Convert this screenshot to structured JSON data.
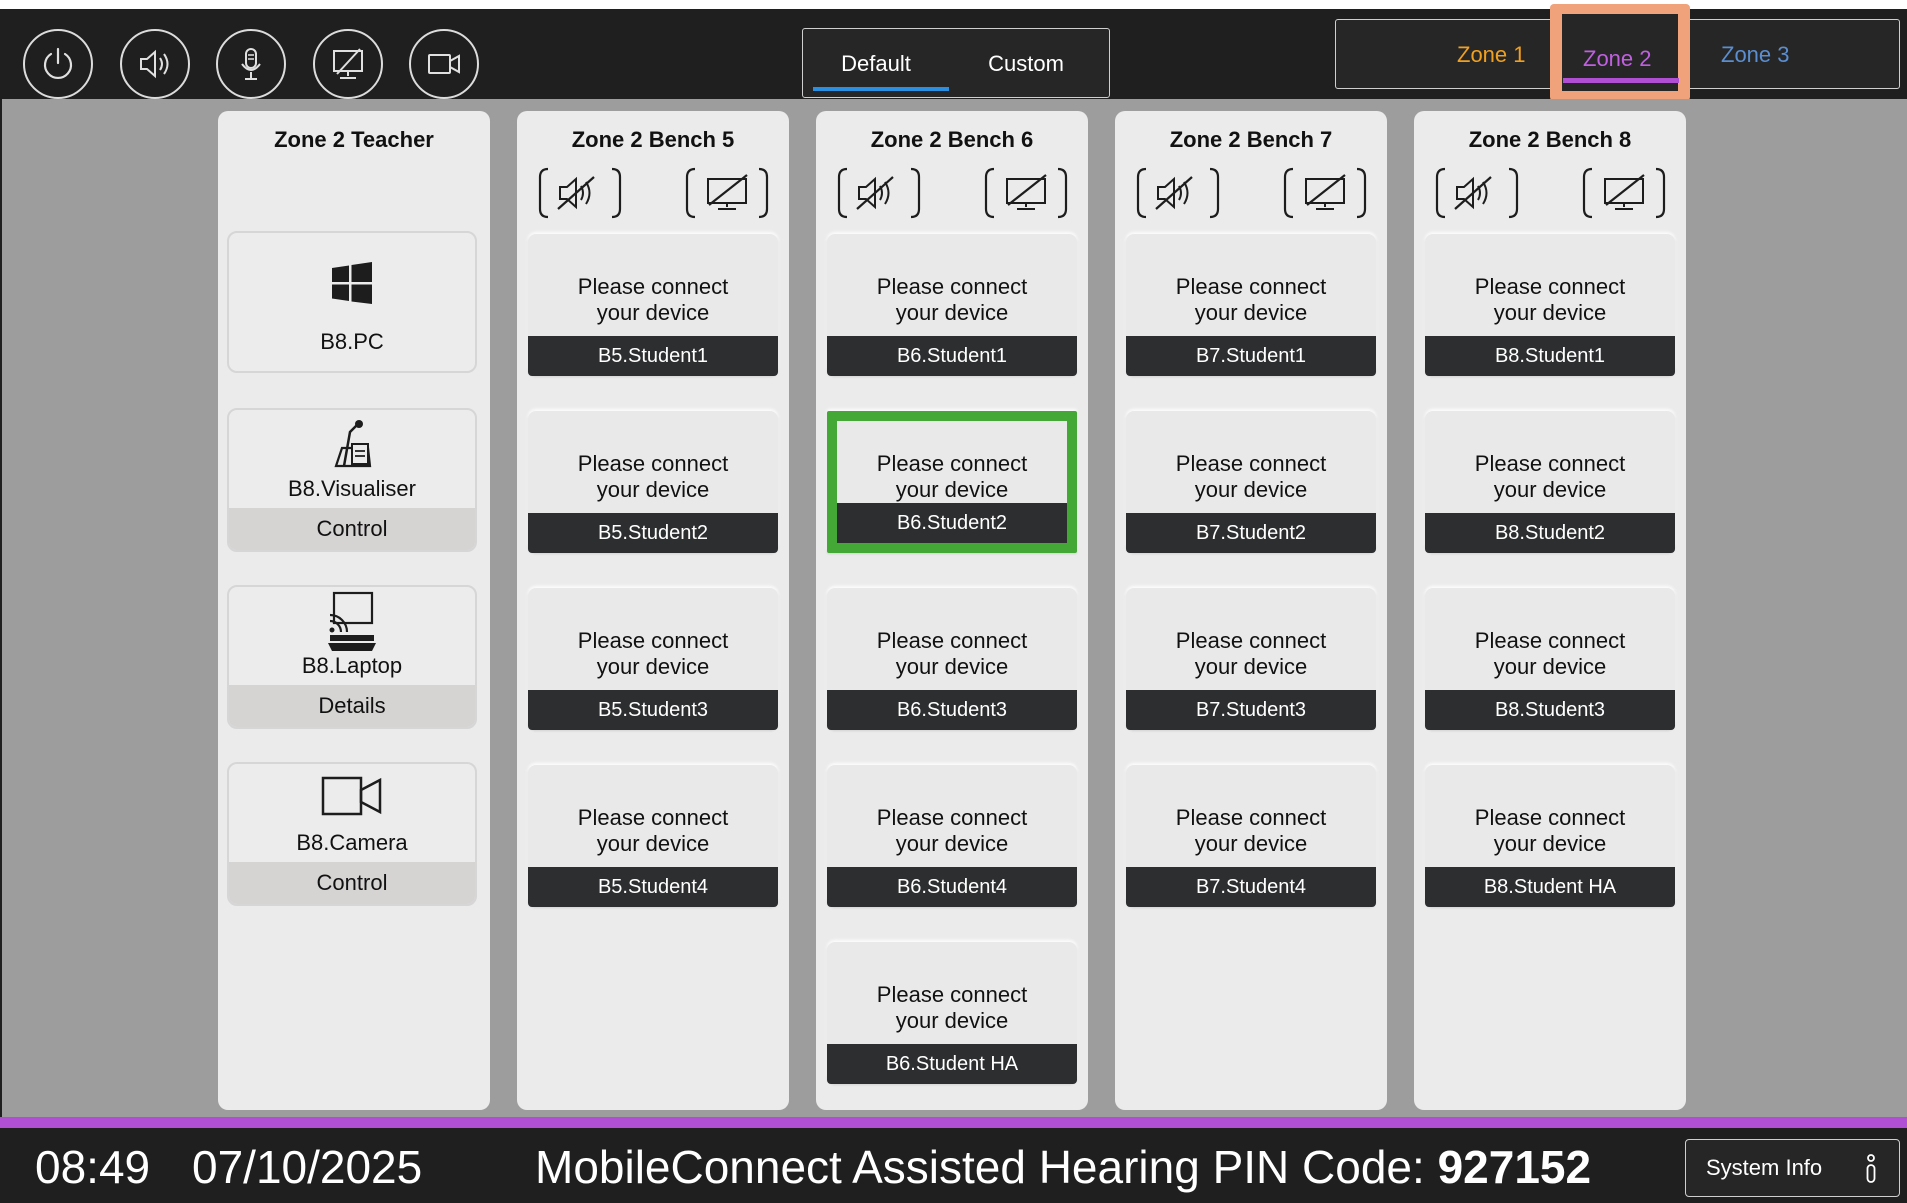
{
  "topbar": {
    "buttons": [
      "power-icon",
      "speaker-icon",
      "microphone-icon",
      "display-off-icon",
      "camera-icon"
    ],
    "mode_tabs": [
      {
        "label": "Default",
        "active": true
      },
      {
        "label": "Custom",
        "active": false
      }
    ],
    "zones": [
      {
        "label": "Zone 1",
        "color": "#f0a020"
      },
      {
        "label": "Zone 2",
        "color": "#c060e0",
        "active": true
      },
      {
        "label": "Zone 3",
        "color": "#5b8ed0"
      }
    ]
  },
  "teacher": {
    "title": "Zone 2 Teacher",
    "devices": [
      {
        "name": "B8.PC",
        "icon": "windows-icon",
        "action": ""
      },
      {
        "name": "B8.Visualiser",
        "icon": "visualiser-icon",
        "action": "Control"
      },
      {
        "name": "B8.Laptop",
        "icon": "laptop-cast-icon",
        "action": "Details"
      },
      {
        "name": "B8.Camera",
        "icon": "camera-icon",
        "action": "Control"
      }
    ]
  },
  "benches": [
    {
      "title": "Zone 2 Bench 5",
      "cards": [
        {
          "message": [
            "Please connect",
            "your device"
          ],
          "label": "B5.Student1"
        },
        {
          "message": [
            "Please connect",
            "your device"
          ],
          "label": "B5.Student2"
        },
        {
          "message": [
            "Please connect",
            "your device"
          ],
          "label": "B5.Student3"
        },
        {
          "message": [
            "Please connect",
            "your device"
          ],
          "label": "B5.Student4"
        }
      ]
    },
    {
      "title": "Zone 2 Bench 6",
      "cards": [
        {
          "message": [
            "Please connect",
            "your device"
          ],
          "label": "B6.Student1"
        },
        {
          "message": [
            "Please connect",
            "your device"
          ],
          "label": "B6.Student2",
          "selected": true
        },
        {
          "message": [
            "Please connect",
            "your device"
          ],
          "label": "B6.Student3"
        },
        {
          "message": [
            "Please connect",
            "your device"
          ],
          "label": "B6.Student4"
        },
        {
          "message": [
            "Please connect",
            "your device"
          ],
          "label": "B6.Student HA"
        }
      ]
    },
    {
      "title": "Zone 2 Bench 7",
      "cards": [
        {
          "message": [
            "Please connect",
            "your device"
          ],
          "label": "B7.Student1"
        },
        {
          "message": [
            "Please connect",
            "your device"
          ],
          "label": "B7.Student2"
        },
        {
          "message": [
            "Please connect",
            "your device"
          ],
          "label": "B7.Student3"
        },
        {
          "message": [
            "Please connect",
            "your device"
          ],
          "label": "B7.Student4"
        }
      ]
    },
    {
      "title": "Zone 2 Bench 8",
      "cards": [
        {
          "message": [
            "Please connect",
            "your device"
          ],
          "label": "B8.Student1"
        },
        {
          "message": [
            "Please connect",
            "your device"
          ],
          "label": "B8.Student2"
        },
        {
          "message": [
            "Please connect",
            "your device"
          ],
          "label": "B8.Student3"
        },
        {
          "message": [
            "Please connect",
            "your device"
          ],
          "label": "B8.Student HA"
        }
      ]
    }
  ],
  "bottombar": {
    "time": "08:49",
    "date": "07/10/2025",
    "pin_label": "MobileConnect Assisted Hearing PIN Code:",
    "pin_value": "927152",
    "system_info": "System Info"
  }
}
